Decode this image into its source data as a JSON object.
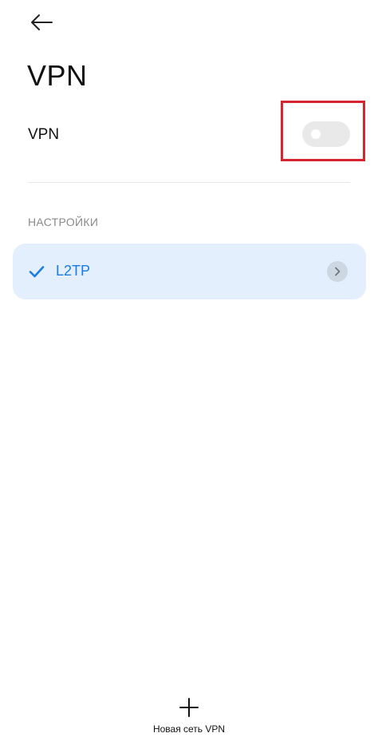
{
  "header": {
    "back_icon": "arrow-left-icon",
    "title": "VPN"
  },
  "vpn_toggle": {
    "label": "VPN",
    "enabled": false
  },
  "settings_section": {
    "header": "НАСТРОЙКИ",
    "items": [
      {
        "label": "L2TP",
        "selected": true,
        "check_icon": "checkmark-icon",
        "details_icon": "chevron-right-icon"
      }
    ]
  },
  "footer": {
    "add_icon": "plus-icon",
    "add_label": "Новая сеть VPN"
  },
  "colors": {
    "accent": "#1a7de3",
    "selected_item_bg": "#e3effc",
    "highlight_border": "#d62430",
    "toggle_off": "#e9e9e9"
  }
}
